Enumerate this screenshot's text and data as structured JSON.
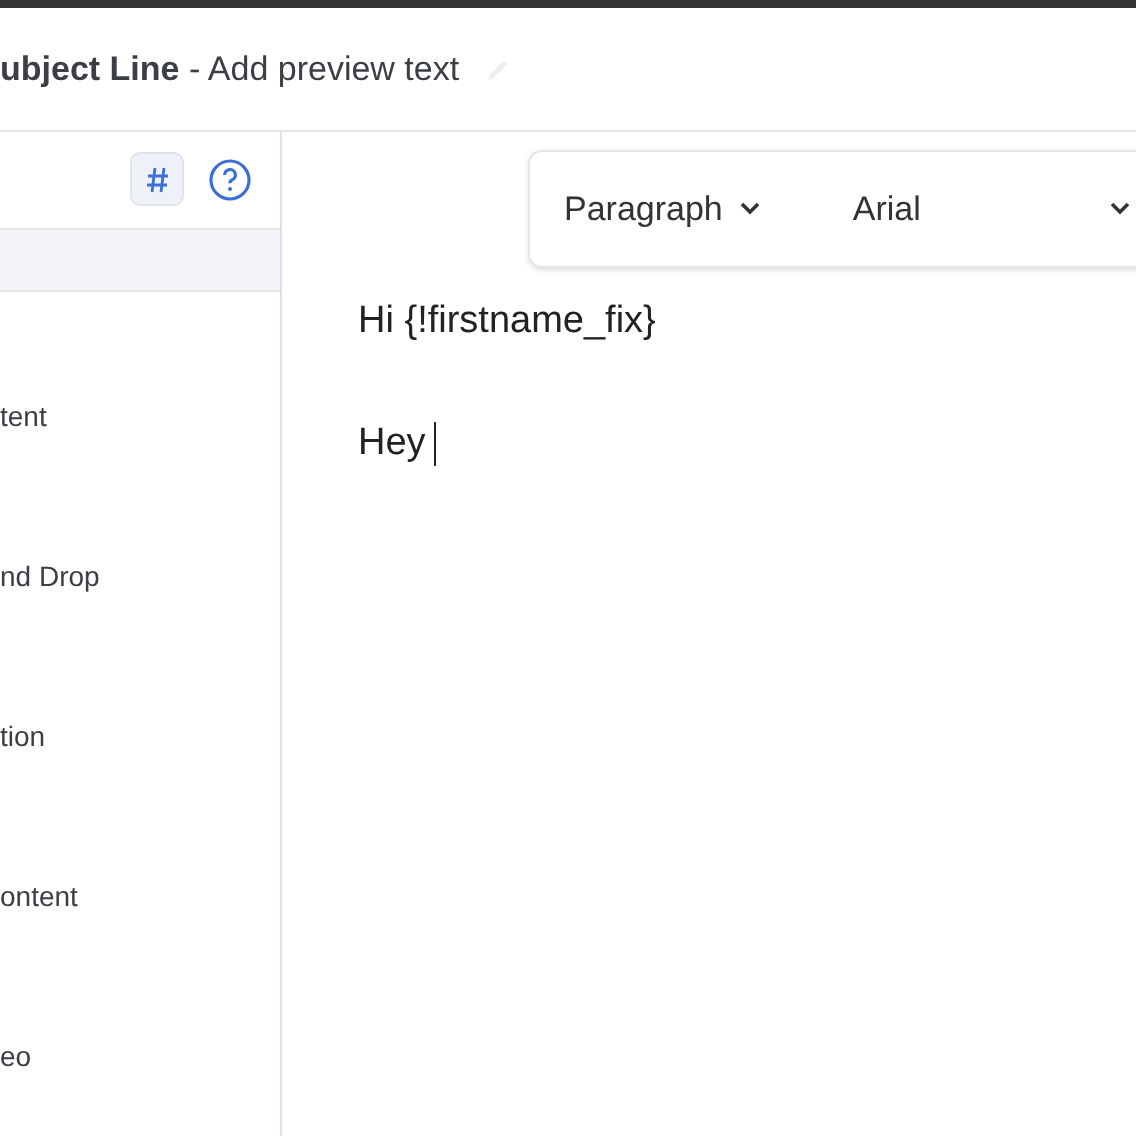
{
  "header": {
    "subject": "ubject Line",
    "separator": " - ",
    "preview": "Add preview text"
  },
  "sidebar": {
    "items": [
      {
        "label": "tent"
      },
      {
        "label": "nd Drop"
      },
      {
        "label": "tion"
      },
      {
        "label": "ontent"
      },
      {
        "label": "eo"
      }
    ]
  },
  "toolbar": {
    "block_format": "Paragraph",
    "font": "Arial"
  },
  "editor": {
    "lines": [
      "Hi {!firstname_fix}",
      "Hey"
    ]
  }
}
